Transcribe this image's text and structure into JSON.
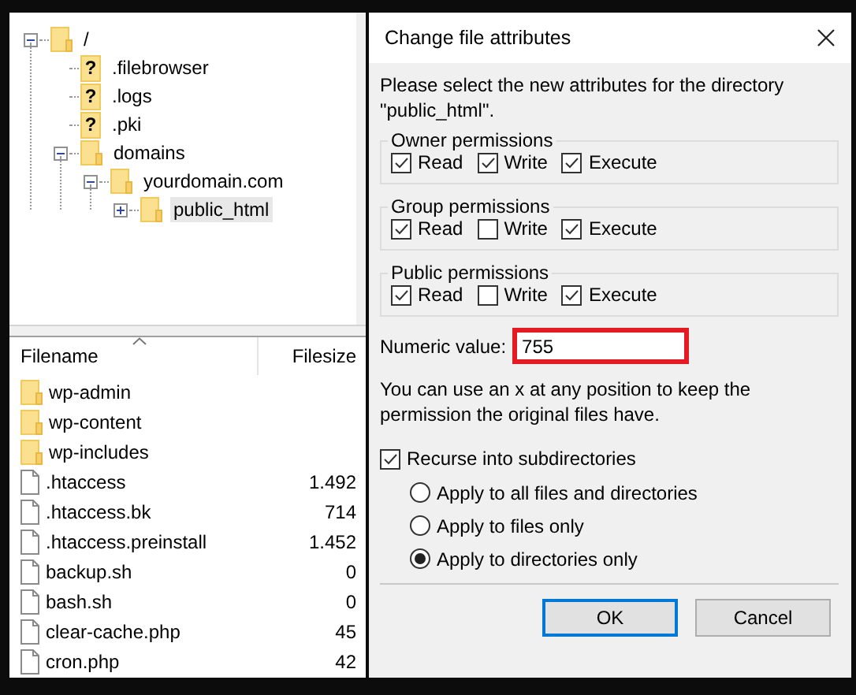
{
  "tree": [
    {
      "label": "/",
      "kind": "folder",
      "expanded": true,
      "selected": false,
      "children": [
        {
          "label": ".filebrowser",
          "kind": "unknown",
          "glyph": "?",
          "selected": false
        },
        {
          "label": ".logs",
          "kind": "unknown",
          "glyph": "?",
          "selected": false
        },
        {
          "label": ".pki",
          "kind": "unknown",
          "glyph": "?",
          "selected": false
        },
        {
          "label": "domains",
          "kind": "folder",
          "expanded": true,
          "selected": false,
          "children": [
            {
              "label": "yourdomain.com",
              "kind": "folder",
              "expanded": true,
              "selected": false,
              "children": [
                {
                  "label": "public_html",
                  "kind": "folder",
                  "expanded": false,
                  "selected": true
                }
              ]
            }
          ]
        }
      ]
    }
  ],
  "file_list": {
    "columns": [
      "Filename",
      "Filesize"
    ],
    "rows": [
      {
        "name": "wp-admin",
        "kind": "folder"
      },
      {
        "name": "wp-content",
        "kind": "folder"
      },
      {
        "name": "wp-includes",
        "kind": "folder"
      },
      {
        "name": ".htaccess",
        "kind": "file",
        "size": "1.492"
      },
      {
        "name": ".htaccess.bk",
        "kind": "file",
        "size": "714"
      },
      {
        "name": ".htaccess.preinstall",
        "kind": "file",
        "size": "1.452"
      },
      {
        "name": "backup.sh",
        "kind": "file",
        "size": "0"
      },
      {
        "name": "bash.sh",
        "kind": "file",
        "size": "0"
      },
      {
        "name": "clear-cache.php",
        "kind": "file",
        "size": "45"
      },
      {
        "name": "cron.php",
        "kind": "file",
        "size": "42"
      }
    ]
  },
  "dialog": {
    "title": "Change file attributes",
    "intro": "Please select the new attributes for the directory \"public_html\".",
    "groups": [
      {
        "title": "Owner permissions",
        "options": [
          {
            "label": "Read",
            "checked": true
          },
          {
            "label": "Write",
            "checked": true
          },
          {
            "label": "Execute",
            "checked": true
          }
        ]
      },
      {
        "title": "Group permissions",
        "options": [
          {
            "label": "Read",
            "checked": true
          },
          {
            "label": "Write",
            "checked": false
          },
          {
            "label": "Execute",
            "checked": true
          }
        ]
      },
      {
        "title": "Public permissions",
        "options": [
          {
            "label": "Read",
            "checked": true
          },
          {
            "label": "Write",
            "checked": false
          },
          {
            "label": "Execute",
            "checked": true
          }
        ]
      }
    ],
    "numeric_label": "Numeric value:",
    "numeric_value": "755",
    "hint": "You can use an x at any position to keep the permission the original files have.",
    "recurse": {
      "label": "Recurse into subdirectories",
      "checked": true
    },
    "apply_options": [
      {
        "label": "Apply to all files and directories",
        "selected": false
      },
      {
        "label": "Apply to files only",
        "selected": false
      },
      {
        "label": "Apply to directories only",
        "selected": true
      }
    ],
    "buttons": [
      {
        "label": "OK",
        "focused": true
      },
      {
        "label": "Cancel",
        "focused": false
      }
    ]
  }
}
